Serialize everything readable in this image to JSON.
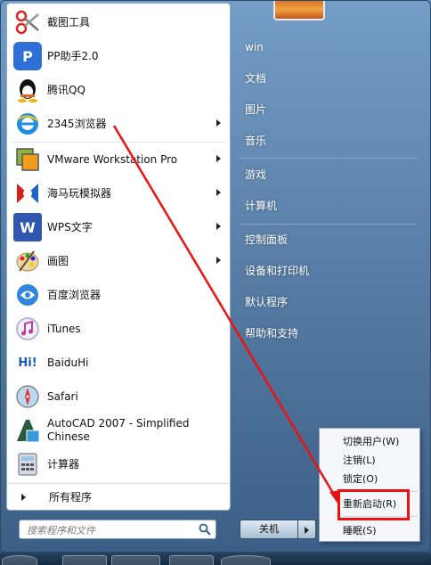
{
  "programs": [
    {
      "label": "截图工具",
      "icon": "scissors-icon",
      "has_arrow": false
    },
    {
      "label": "PP助手2.0",
      "icon": "pp-assistant-icon",
      "has_arrow": false
    },
    {
      "label": "腾讯QQ",
      "icon": "qq-penguin-icon",
      "has_arrow": false
    },
    {
      "label": "2345浏览器",
      "icon": "browser-e-icon",
      "has_arrow": true
    },
    {
      "label": "VMware Workstation Pro",
      "icon": "vmware-icon",
      "has_arrow": true
    },
    {
      "label": "海马玩模拟器",
      "icon": "haima-icon",
      "has_arrow": true
    },
    {
      "label": "WPS文字",
      "icon": "wps-writer-icon",
      "has_arrow": true
    },
    {
      "label": "画图",
      "icon": "paint-palette-icon",
      "has_arrow": true
    },
    {
      "label": "百度浏览器",
      "icon": "baidu-browser-icon",
      "has_arrow": false
    },
    {
      "label": "iTunes",
      "icon": "itunes-icon",
      "has_arrow": false
    },
    {
      "label": "BaiduHi",
      "icon": "baiduhi-icon",
      "has_arrow": false
    },
    {
      "label": "Safari",
      "icon": "safari-compass-icon",
      "has_arrow": false
    },
    {
      "label": "AutoCAD 2007 - Simplified Chinese",
      "icon": "autocad-icon",
      "has_arrow": false
    },
    {
      "label": "计算器",
      "icon": "calculator-icon",
      "has_arrow": false
    }
  ],
  "all_programs_label": "所有程序",
  "search_placeholder": "搜索程序和文件",
  "icon_texts": {
    "pp": "P",
    "wps": "W",
    "hi": "Hi!"
  },
  "right_items": [
    "win",
    "文档",
    "图片",
    "音乐",
    "游戏",
    "计算机",
    "控制面板",
    "设备和打印机",
    "默认程序",
    "帮助和支持"
  ],
  "shutdown_label": "关机",
  "popup_items": [
    "切换用户(W)",
    "注销(L)",
    "锁定(O)",
    "重新启动(R)",
    "睡眠(S)"
  ],
  "colors": {
    "highlight": "#ea1212"
  }
}
